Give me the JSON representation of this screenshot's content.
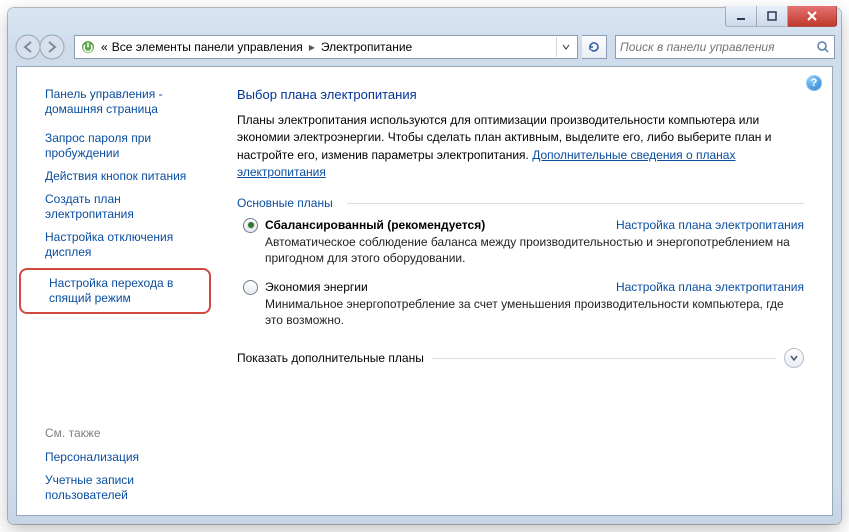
{
  "breadcrumb": {
    "prefix": "«",
    "parent": "Все элементы панели управления",
    "current": "Электропитание"
  },
  "search": {
    "placeholder": "Поиск в панели управления"
  },
  "sidebar": {
    "links": [
      "Панель управления - домашняя страница",
      "Запрос пароля при пробуждении",
      "Действия кнопок питания",
      "Создать план электропитания",
      "Настройка отключения дисплея",
      "Настройка перехода в спящий режим"
    ],
    "see_also_label": "См. также",
    "see_also": [
      "Персонализация",
      "Учетные записи пользователей"
    ]
  },
  "main": {
    "title": "Выбор плана электропитания",
    "intro_text": "Планы электропитания используются для оптимизации производительности компьютера или экономии электроэнергии. Чтобы сделать план активным, выделите его, либо выберите план и настройте его, изменив параметры электропитания. ",
    "intro_link": "Дополнительные сведения о планах электропитания",
    "group": "Основные планы",
    "plan_settings_link": "Настройка плана электропитания",
    "plans": [
      {
        "name": "Сбалансированный (рекомендуется)",
        "desc": "Автоматическое соблюдение баланса между производительностью и энергопотреблением на пригодном для этого оборудовании."
      },
      {
        "name": "Экономия энергии",
        "desc": "Минимальное энергопотребление за счет уменьшения производительности компьютера, где это возможно."
      }
    ],
    "show_more": "Показать дополнительные планы",
    "help_glyph": "?"
  }
}
